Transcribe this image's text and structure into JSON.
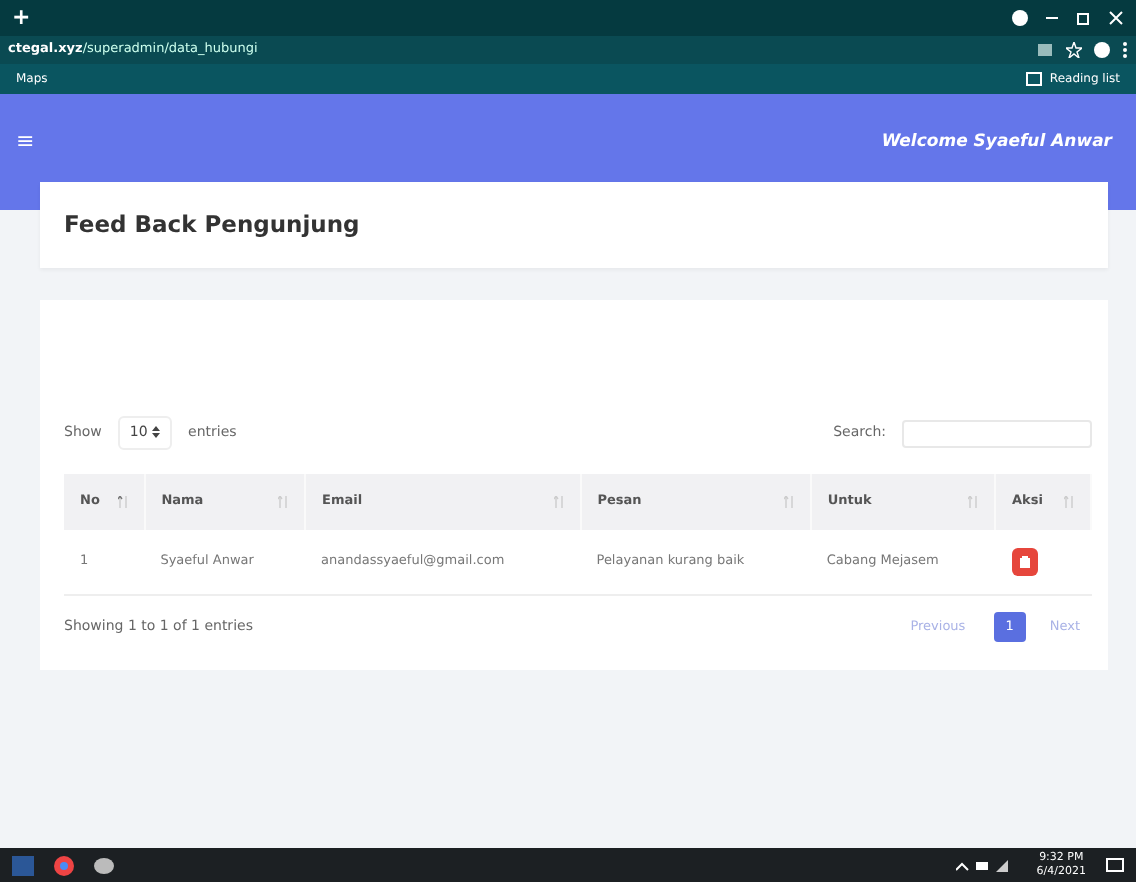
{
  "browser": {
    "new_tab": "+",
    "address_host": "ctegal.xyz",
    "address_path": "/superadmin/data_hubungi",
    "bookmarks": [
      "Maps"
    ],
    "reading_list": "Reading list"
  },
  "header": {
    "menu": "≡",
    "welcome": "Welcome Syaeful Anwar"
  },
  "page_title": "Feed Back Pengunjung",
  "table_controls": {
    "show": "Show",
    "entries_value": "10",
    "entries": "entries",
    "search_label": "Search:"
  },
  "table": {
    "columns": [
      {
        "label": "No",
        "sorted": true
      },
      {
        "label": "Nama",
        "sorted": false
      },
      {
        "label": "Email",
        "sorted": false
      },
      {
        "label": "Pesan",
        "sorted": false
      },
      {
        "label": "Untuk",
        "sorted": false
      },
      {
        "label": "Aksi",
        "sorted": false
      }
    ],
    "rows": [
      [
        "1",
        "Syaeful Anwar",
        "anandassyaeful@gmail.com",
        "Pelayanan kurang baik",
        "Cabang Mejasem"
      ]
    ]
  },
  "info": "Showing 1 to 1 of 1 entries",
  "pagination": [
    {
      "label": "Previous",
      "kind": "prev",
      "selected": false
    },
    {
      "label": "1",
      "kind": "page",
      "selected": true
    },
    {
      "label": "Next",
      "kind": "next",
      "selected": false
    }
  ],
  "taskbar": {
    "time": "9:32 PM",
    "date": "6/4/2021"
  }
}
